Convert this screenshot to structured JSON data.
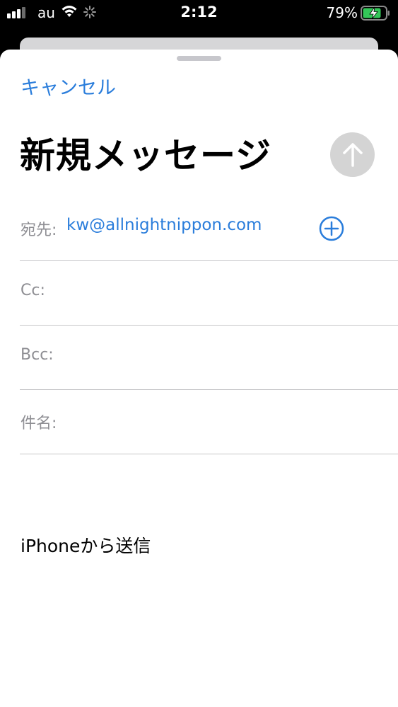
{
  "status_bar": {
    "carrier": "au",
    "time": "2:12",
    "battery_percent": "79%",
    "icons": [
      "signal-icon",
      "wifi-icon",
      "activity-spinner-icon",
      "battery-charging-icon"
    ],
    "battery_color": "#34c759"
  },
  "compose": {
    "cancel_label": "キャンセル",
    "title": "新規メッセージ",
    "send_icon": "arrow-up-icon",
    "fields": {
      "to_label": "宛先:",
      "to_value": "kw@allnightnippon.com",
      "add_icon": "plus-circle-icon",
      "cc_label": "Cc:",
      "bcc_label": "Bcc:",
      "subject_label": "件名:"
    },
    "body_signature": "iPhoneから送信"
  },
  "colors": {
    "accent": "#2a7ddb",
    "label_gray": "#8e8e93",
    "send_disabled": "#d4d4d4"
  }
}
